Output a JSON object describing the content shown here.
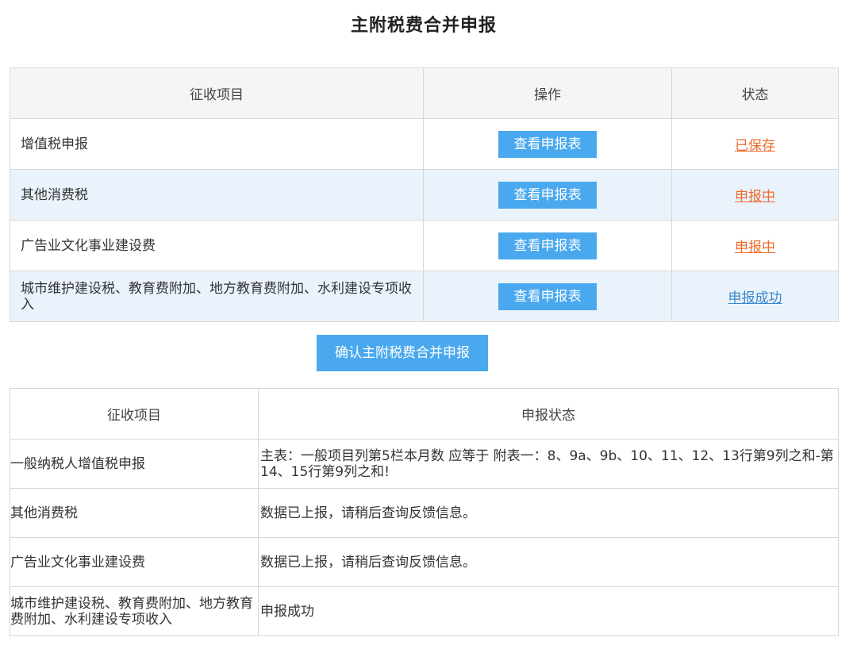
{
  "page": {
    "title": "主附税费合并申报"
  },
  "main_table": {
    "headers": {
      "item": "征收项目",
      "operation": "操作",
      "status": "状态"
    },
    "rows": [
      {
        "item": "增值税申报",
        "button": "查看申报表",
        "status": "已保存"
      },
      {
        "item": "其他消费税",
        "button": "查看申报表",
        "status": "申报中"
      },
      {
        "item": "广告业文化事业建设费",
        "button": "查看申报表",
        "status": "申报中"
      },
      {
        "item": "城市维护建设税、教育费附加、地方教育费附加、水利建设专项收入",
        "button": "查看申报表",
        "status": "申报成功"
      }
    ]
  },
  "confirm_button": "确认主附税费合并申报",
  "result_table": {
    "headers": {
      "item": "征收项目",
      "status": "申报状态"
    },
    "rows": [
      {
        "item": "一般纳税人增值税申报",
        "status": "主表：一般项目列第5栏本月数 应等于 附表一：8、9a、9b、10、11、12、13行第9列之和-第14、15行第9列之和!"
      },
      {
        "item": "其他消费税",
        "status": "数据已上报，请稍后查询反馈信息。"
      },
      {
        "item": "广告业文化事业建设费",
        "status": "数据已上报，请稍后查询反馈信息。"
      },
      {
        "item": "城市维护建设税、教育费附加、地方教育费附加、水利建设专项收入",
        "status": "申报成功"
      }
    ]
  },
  "colors": {
    "button_blue": "#4aa9ee",
    "status_orange": "#f06a2a",
    "status_blue": "#3a88cf",
    "alt_row": "#eaf3fc",
    "header_bg": "#f5f5f5"
  }
}
